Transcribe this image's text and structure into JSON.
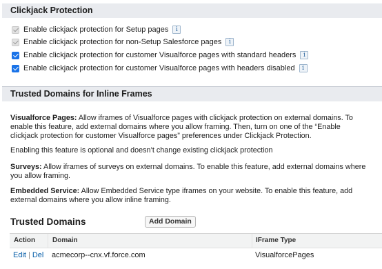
{
  "clickjack": {
    "title": "Clickjack Protection",
    "options": [
      {
        "label": "Enable clickjack protection for Setup pages",
        "state": "checked-disabled"
      },
      {
        "label": "Enable clickjack protection for non-Setup Salesforce pages",
        "state": "checked-disabled"
      },
      {
        "label": "Enable clickjack protection for customer Visualforce pages with standard headers",
        "state": "checked"
      },
      {
        "label": "Enable clickjack protection for customer Visualforce pages with headers disabled",
        "state": "checked"
      }
    ],
    "info_glyph": "i"
  },
  "trusted": {
    "title": "Trusted Domains for Inline Frames",
    "vf_label": "Visualforce Pages:",
    "vf_text_1": " Allow iframes of Visualforce pages with clickjack protection on external domains. To",
    "vf_text_2": "enable this feature, add external domains where you allow framing. Then, turn on one of the “Enable",
    "vf_text_3": "clickjack protection for customer Visualforce pages” preferences under Clickjack Protection.",
    "optional_text": "Enabling this feature is optional and doesn’t change existing clickjack protection",
    "surveys_label": "Surveys:",
    "surveys_text_1": " Allow iframes of surveys on external domains. To enable this feature, add external domains where",
    "surveys_text_2": "you allow framing.",
    "embedded_label": "Embedded Service:",
    "embedded_text_1": " Allow Embedded Service type iframes on your website. To enable this feature, add",
    "embedded_text_2": "external domains where you allow inline framing."
  },
  "domains": {
    "title": "Trusted Domains",
    "add_button": "Add Domain",
    "columns": [
      "Action",
      "Domain",
      "IFrame Type"
    ],
    "rows": [
      {
        "edit": "Edit",
        "sep": "|",
        "del": "Del",
        "domain": "acmecorp--cnx.vf.force.com",
        "type": "VisualforcePages"
      }
    ]
  },
  "colors": {
    "checkbox_checked": "#1a73e8",
    "link": "#015ba7",
    "section_bg": "#e9ebef"
  }
}
